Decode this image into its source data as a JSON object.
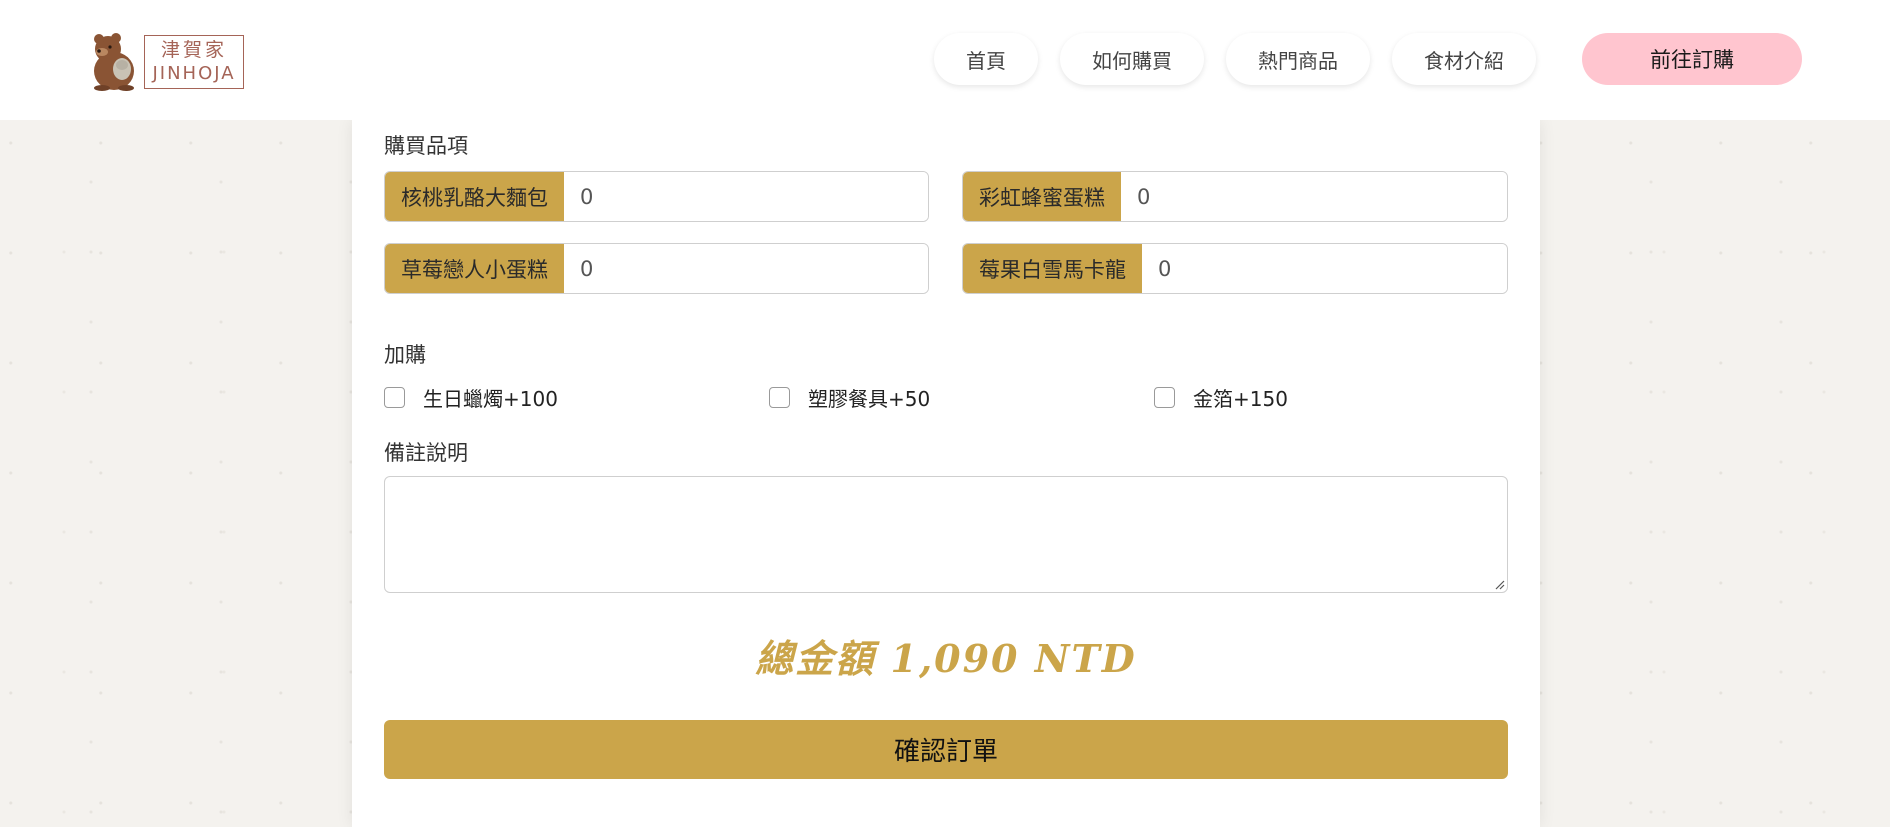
{
  "header": {
    "logo_cn": "津賀家",
    "logo_en": "JINHOJA",
    "nav": [
      "首頁",
      "如何購買",
      "熱門商品",
      "食材介紹"
    ],
    "cta": "前往訂購"
  },
  "form": {
    "items_label": "購買品項",
    "items": [
      {
        "name": "核桃乳酪大麵包",
        "qty": "0"
      },
      {
        "name": "彩虹蜂蜜蛋糕",
        "qty": "0"
      },
      {
        "name": "草莓戀人小蛋糕",
        "qty": "0"
      },
      {
        "name": "莓果白雪馬卡龍",
        "qty": "0"
      }
    ],
    "addons_label": "加購",
    "addons": [
      "生日蠟燭+100",
      "塑膠餐具+50",
      "金箔+150"
    ],
    "remark_label": "備註說明",
    "total": "總金額 1,090 NTD",
    "submit": "確認訂單"
  },
  "colors": {
    "accent": "#cba54a",
    "cta_pink": "#ffc5cf",
    "logo_brown": "#a56457"
  }
}
